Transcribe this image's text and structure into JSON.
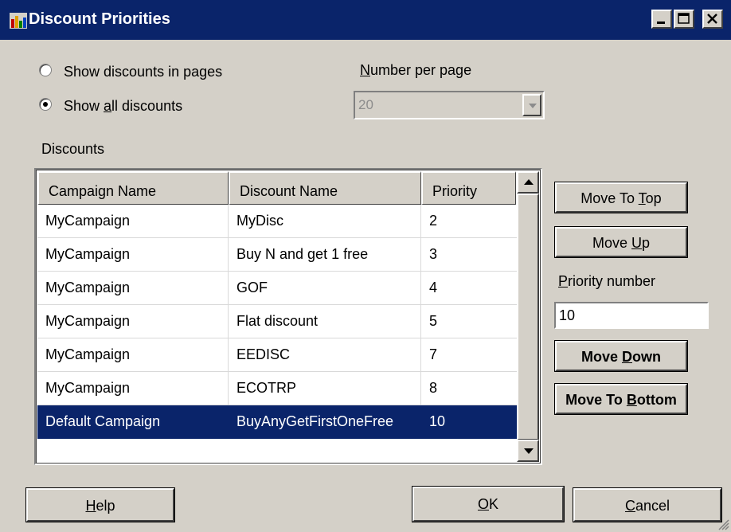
{
  "window": {
    "title": "Discount Priorities",
    "controls": {
      "minimize": "_",
      "maximize": "□",
      "close": "×"
    },
    "colors": {
      "titlebar": "#0a246a",
      "face": "#d4d0c8",
      "selection": "#0a246a"
    }
  },
  "display_options": {
    "option_pages": "Show discounts in pages",
    "option_all_prefix": "Show ",
    "option_all_mnemonic": "a",
    "option_all_suffix": "ll discounts",
    "selected": "all"
  },
  "number_per_page": {
    "label_mnemonic": "N",
    "label_rest": "umber per page",
    "value": "20",
    "enabled": false
  },
  "discounts": {
    "group_label": "Discounts",
    "columns": [
      "Campaign Name",
      "Discount Name",
      "Priority"
    ],
    "rows": [
      {
        "campaign": "MyCampaign",
        "discount": "MyDisc",
        "priority": "2"
      },
      {
        "campaign": "MyCampaign",
        "discount": "Buy N and get 1 free",
        "priority": "3"
      },
      {
        "campaign": "MyCampaign",
        "discount": "GOF",
        "priority": "4"
      },
      {
        "campaign": "MyCampaign",
        "discount": "Flat discount",
        "priority": "5"
      },
      {
        "campaign": "MyCampaign",
        "discount": "EEDISC",
        "priority": "7"
      },
      {
        "campaign": "MyCampaign",
        "discount": "ECOTRP",
        "priority": "8"
      },
      {
        "campaign": "Default Campaign",
        "discount": "BuyAnyGetFirstOneFree",
        "priority": "10"
      }
    ],
    "selected_row": 6
  },
  "side_actions": {
    "move_top": {
      "prefix": "Move To ",
      "mnemonic": "T",
      "suffix": "op"
    },
    "move_up": {
      "prefix": "Move ",
      "mnemonic": "U",
      "suffix": "p"
    },
    "priority_label": {
      "mnemonic": "P",
      "rest": "riority number"
    },
    "priority_value": "10",
    "move_down": {
      "prefix": "Move ",
      "mnemonic": "D",
      "suffix": "own"
    },
    "move_bottom": {
      "prefix": "Move To ",
      "mnemonic": "B",
      "suffix": "ottom"
    }
  },
  "footer": {
    "help": {
      "mnemonic": "H",
      "suffix": "elp"
    },
    "ok": {
      "mnemonic": "O",
      "suffix": "K"
    },
    "cancel": {
      "mnemonic": "C",
      "suffix": "ancel"
    }
  }
}
